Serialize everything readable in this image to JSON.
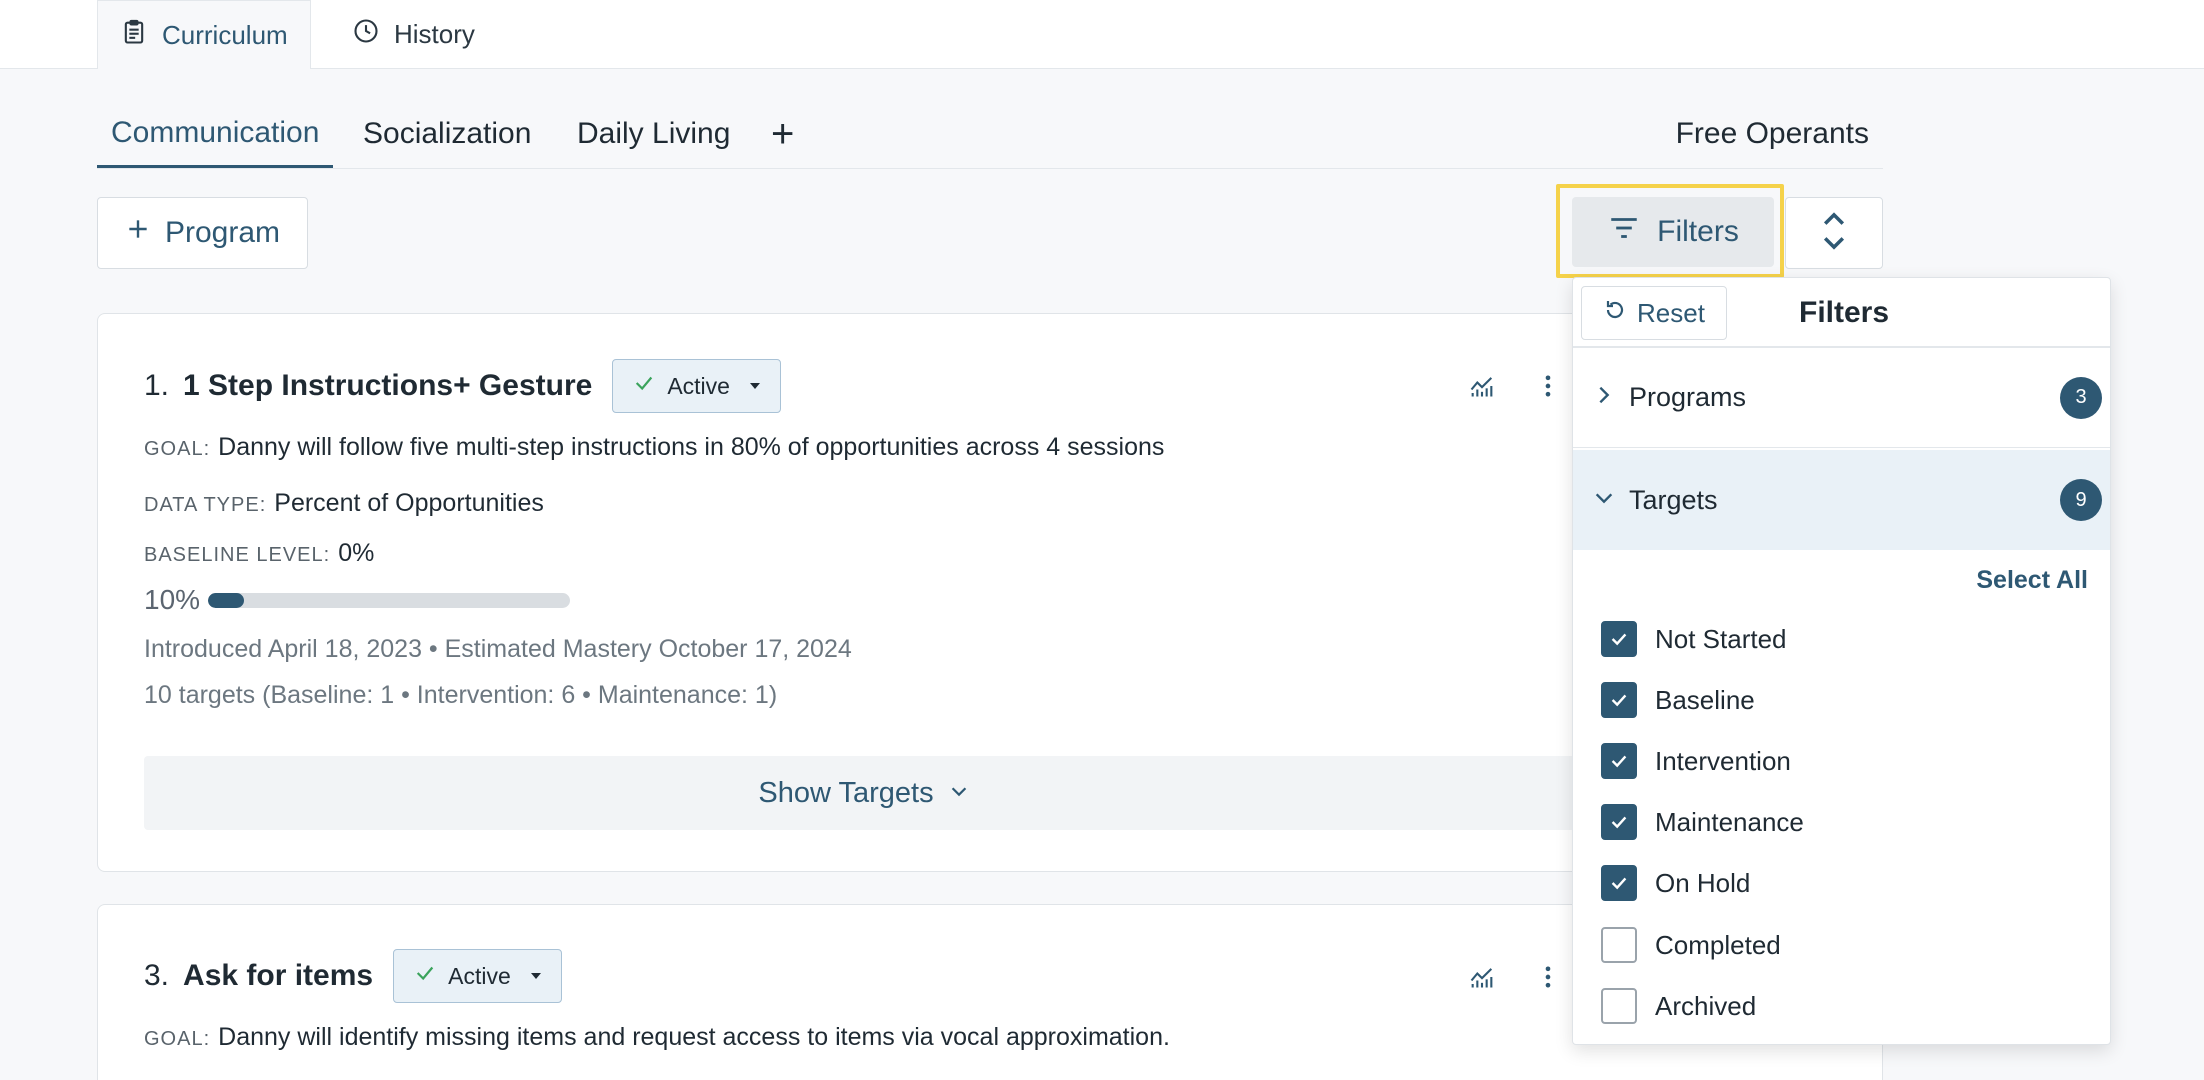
{
  "top_tabs": [
    {
      "label": "Curriculum",
      "icon": "clipboard-icon",
      "active": true
    },
    {
      "label": "History",
      "icon": "clock-icon",
      "active": false
    }
  ],
  "subject_tabs": [
    {
      "label": "Communication",
      "active": true
    },
    {
      "label": "Socialization",
      "active": false
    },
    {
      "label": "Daily Living",
      "active": false
    }
  ],
  "add_tab_label": "+",
  "free_operants_label": "Free Operants",
  "toolbar": {
    "program_label": "Program",
    "filters_label": "Filters"
  },
  "programs": [
    {
      "number": "1.",
      "name": "1 Step Instructions+ Gesture",
      "status": "Active",
      "goal_label": "GOAL:",
      "goal": "Danny will follow five multi-step instructions in 80% of opportunities across 4 sessions",
      "data_type_label": "DATA TYPE:",
      "data_type": "Percent of Opportunities",
      "baseline_label": "BASELINE LEVEL:",
      "baseline": "0%",
      "progress_text": "10%",
      "progress_value": 0.1,
      "dates": "Introduced April 18, 2023 • Estimated Mastery October 17, 2024",
      "targets_summary": "10 targets (Baseline: 1 • Intervention: 6 • Maintenance: 1)",
      "show_targets_label": "Show Targets"
    },
    {
      "number": "3.",
      "name": "Ask for items",
      "status": "Active",
      "goal_label": "GOAL:",
      "goal": "Danny will identify missing items and request access to items via vocal approximation."
    }
  ],
  "filters_panel": {
    "reset_label": "Reset",
    "title": "Filters",
    "sections": [
      {
        "label": "Programs",
        "count": "3",
        "expanded": false
      },
      {
        "label": "Targets",
        "count": "9",
        "expanded": true
      }
    ],
    "select_all_label": "Select All",
    "options": [
      {
        "label": "Not Started",
        "checked": true
      },
      {
        "label": "Baseline",
        "checked": true
      },
      {
        "label": "Intervention",
        "checked": true
      },
      {
        "label": "Maintenance",
        "checked": true
      },
      {
        "label": "On Hold",
        "checked": true
      },
      {
        "label": "Completed",
        "checked": false
      },
      {
        "label": "Archived",
        "checked": false
      }
    ]
  },
  "colors": {
    "primary": "#2e5873",
    "highlight": "#f5d24a",
    "active_check": "#3aa35c"
  }
}
